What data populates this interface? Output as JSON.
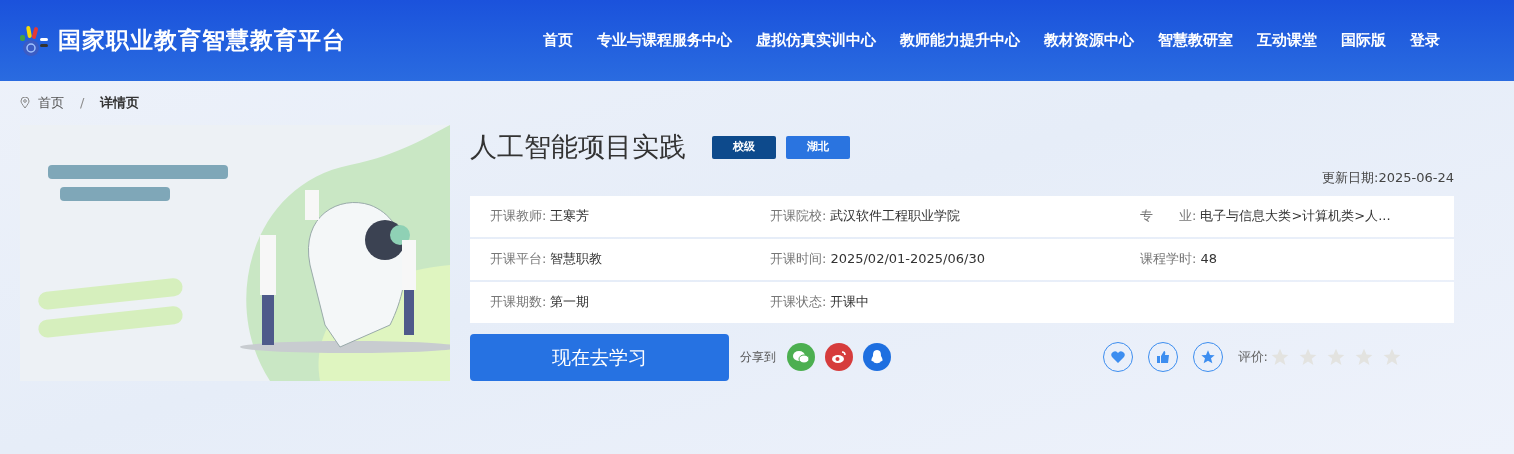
{
  "header": {
    "site_title": "国家职业教育智慧教育平台",
    "nav": [
      {
        "label": "首页"
      },
      {
        "label": "专业与课程服务中心"
      },
      {
        "label": "虚拟仿真实训中心"
      },
      {
        "label": "教师能力提升中心"
      },
      {
        "label": "教材资源中心"
      },
      {
        "label": "智慧教研室"
      },
      {
        "label": "互动课堂"
      },
      {
        "label": "国际版"
      },
      {
        "label": "登录"
      }
    ]
  },
  "breadcrumb_separator": "/",
  "breadcrumb": [
    {
      "label": "首页",
      "current": false
    },
    {
      "label": "详情页",
      "current": true
    }
  ],
  "course": {
    "cover": {
      "kind": "picture"
    },
    "title": "人工智能项目实践",
    "tags": [
      {
        "label": "校级",
        "color": "#0d4a8c"
      },
      {
        "label": "湖北",
        "color": "#2a74e0"
      }
    ],
    "updated": "更新日期:2025-06-24",
    "info_rows": [
      [
        {
          "label": "开课教师:",
          "value": "王寒芳"
        },
        {
          "label": "开课院校:",
          "value": "武汉软件工程职业学院"
        },
        {
          "label": "专　　业:",
          "value": "电子与信息大类>计算机类>人..."
        }
      ],
      [
        {
          "label": "开课平台:",
          "value": "智慧职教"
        },
        {
          "label": "开课时间:",
          "value": "2025/02/01-2025/06/30"
        },
        {
          "label": "课程学时:",
          "value": "48"
        }
      ],
      [
        {
          "label": "开课期数:",
          "value": "第一期"
        },
        {
          "label": "开课状态:",
          "value": "开课中"
        }
      ]
    ],
    "study_button": "现在去学习",
    "share_label": "分享到",
    "rating_label": "评价:",
    "stars": 0
  }
}
